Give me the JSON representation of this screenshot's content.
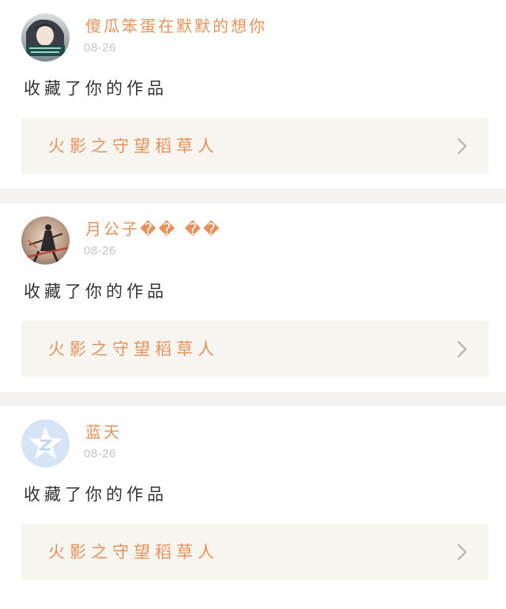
{
  "feed": {
    "items": [
      {
        "user": {
          "name": "傻瓜笨蛋在默默的想你",
          "avatar_icon": "girl-photo-avatar"
        },
        "date": "08-26",
        "action": "收藏了你的作品",
        "work": {
          "title": "火影之守望稻草人"
        }
      },
      {
        "user": {
          "name": "月公子�� ��",
          "avatar_icon": "warrior-art-avatar"
        },
        "date": "08-26",
        "action": "收藏了你的作品",
        "work": {
          "title": "火影之守望稻草人"
        }
      },
      {
        "user": {
          "name": "蓝天",
          "avatar_icon": "default-qq-avatar"
        },
        "date": "08-26",
        "action": "收藏了你的作品",
        "work": {
          "title": "火影之守望稻草人"
        }
      }
    ]
  },
  "colors": {
    "accent": "#e8905a",
    "date": "#c4c4c4",
    "text": "#333333",
    "work_bg": "#f6f5ef",
    "separator": "#f4f3f1"
  }
}
